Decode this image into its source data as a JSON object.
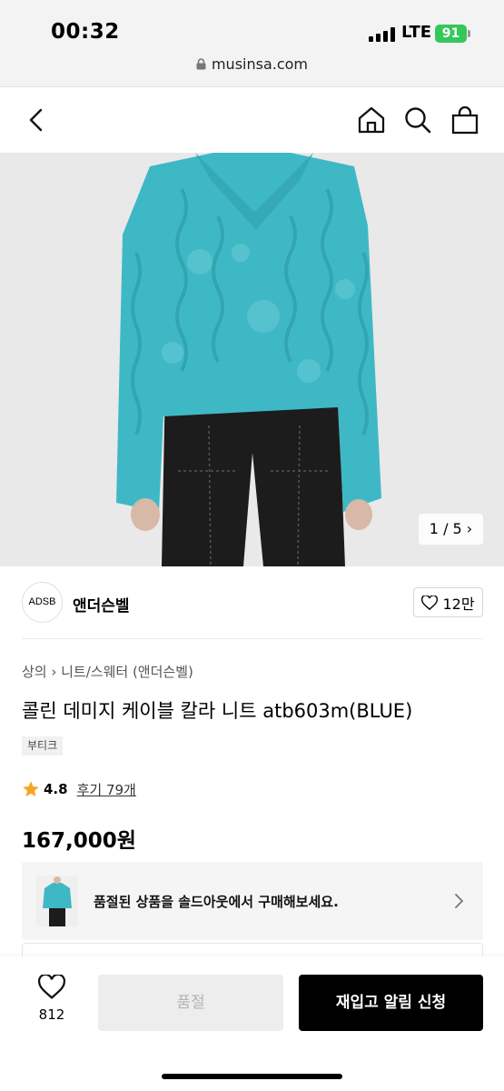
{
  "status_bar": {
    "time": "00:32",
    "network": "LTE",
    "battery": "91"
  },
  "browser": {
    "url": "musinsa.com"
  },
  "header": {
    "icons": [
      "back-icon",
      "home-icon",
      "search-icon",
      "bag-icon"
    ]
  },
  "gallery": {
    "counter": "1 / 5 ›"
  },
  "brand": {
    "logo_text": "ADSB",
    "name": "앤더슨벨",
    "likes": "12만"
  },
  "product": {
    "category": "상의 › 니트/스웨터 (앤더슨벨)",
    "title": "콜린 데미지 케이블 칼라 니트 atb603m(BLUE)",
    "tag": "부티크",
    "rating": "4.8",
    "review": "후기 79개",
    "price": "167,000원"
  },
  "soldout_banner": {
    "text": "품절된 상품을 솔드아웃에서 구매해보세요."
  },
  "bottom_bar": {
    "wish_count": "812",
    "soldout_label": "품절",
    "restock_label": "재입고 알림 신청"
  },
  "colors": {
    "accent": "#000000",
    "star": "#f5a623",
    "battery": "#34c759",
    "sweater": "#3fb8c6"
  }
}
